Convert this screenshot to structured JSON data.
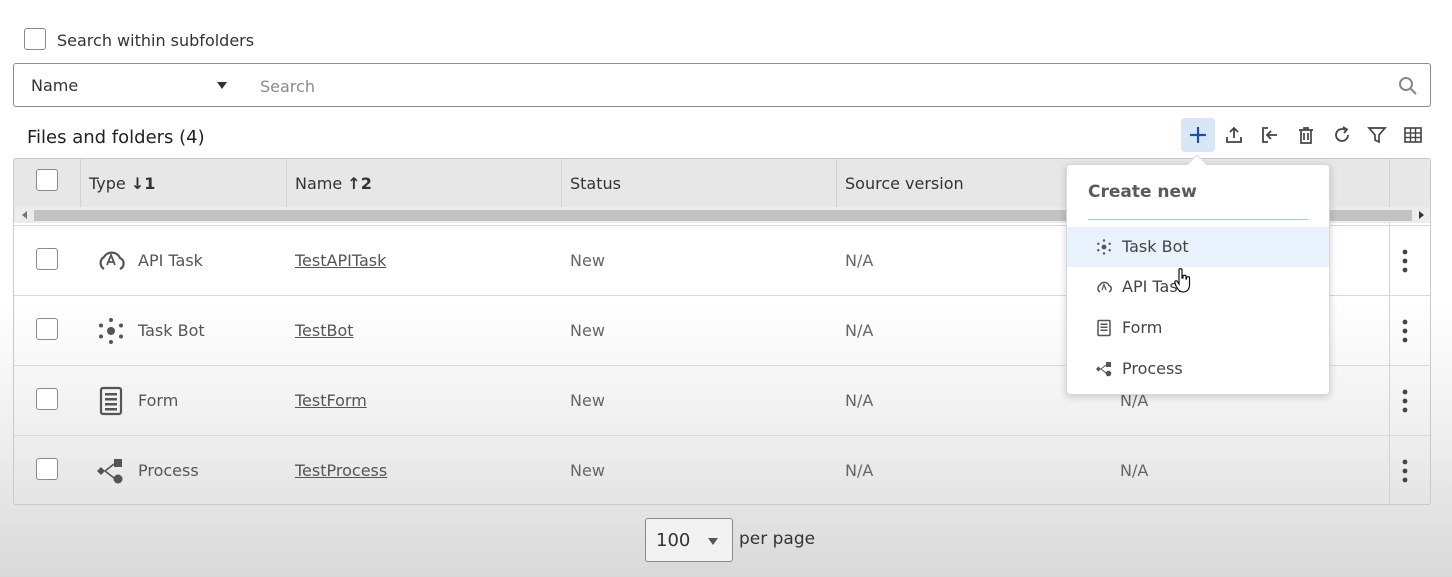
{
  "search_options": {
    "subfolders_label": "Search within subfolders",
    "field_select_value": "Name",
    "search_placeholder": "Search"
  },
  "header": {
    "title": "Files and folders (4)"
  },
  "toolbar": {
    "icons": [
      "plus-icon",
      "upload-icon",
      "import-icon",
      "trash-icon",
      "refresh-icon",
      "filter-icon",
      "columns-icon"
    ]
  },
  "table": {
    "columns": {
      "type": "Type",
      "type_sort": "↓1",
      "name": "Name",
      "name_sort": "↑2",
      "status": "Status",
      "source_version": "Source version"
    },
    "rows": [
      {
        "type": "API Task",
        "icon": "api-task-icon",
        "name": "TestAPITask",
        "status": "New",
        "source": "N/A",
        "extra": ""
      },
      {
        "type": "Task Bot",
        "icon": "task-bot-icon",
        "name": "TestBot",
        "status": "New",
        "source": "N/A",
        "extra": ""
      },
      {
        "type": "Form",
        "icon": "form-icon",
        "name": "TestForm",
        "status": "New",
        "source": "N/A",
        "extra": "N/A"
      },
      {
        "type": "Process",
        "icon": "process-icon",
        "name": "TestProcess",
        "status": "New",
        "source": "N/A",
        "extra": "N/A"
      }
    ]
  },
  "pagination": {
    "page_size": "100",
    "per_page_label": "per page"
  },
  "create_menu": {
    "title": "Create new",
    "items": [
      {
        "label": "Task Bot",
        "icon": "task-bot-icon"
      },
      {
        "label": "API Task",
        "icon": "api-task-icon"
      },
      {
        "label": "Form",
        "icon": "form-icon"
      },
      {
        "label": "Process",
        "icon": "process-icon"
      }
    ]
  },
  "colors": {
    "accent_highlight": "#d8e6f7",
    "menu_separator": "#9fcfbf"
  }
}
